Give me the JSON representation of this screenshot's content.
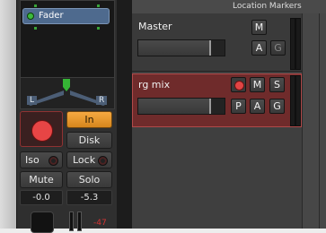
{
  "mixer_strip": {
    "plugin": {
      "name": "Fader"
    },
    "panner": {
      "left_label": "L",
      "right_label": "R"
    },
    "buttons": {
      "input": "In",
      "disk": "Disk",
      "iso": "Iso",
      "lock": "Lock",
      "mute": "Mute",
      "solo": "Solo"
    },
    "gain": {
      "left": "-0.0",
      "right": "-5.3"
    },
    "peak_label": "-47"
  },
  "editor": {
    "ruler_label": "Location Markers",
    "tracks": [
      {
        "name": "Master",
        "buttons": {
          "mute": "M",
          "automation": "A",
          "group": "G"
        }
      },
      {
        "name": "rg mix",
        "buttons": {
          "mute": "M",
          "solo": "S",
          "playlist": "P",
          "automation": "A",
          "group": "G"
        }
      }
    ]
  },
  "colors": {
    "accent_orange": "#e3982f",
    "record_red": "#e74545",
    "selected_track": "#6f2b2b",
    "plugin_blue": "#4e6a8e"
  }
}
